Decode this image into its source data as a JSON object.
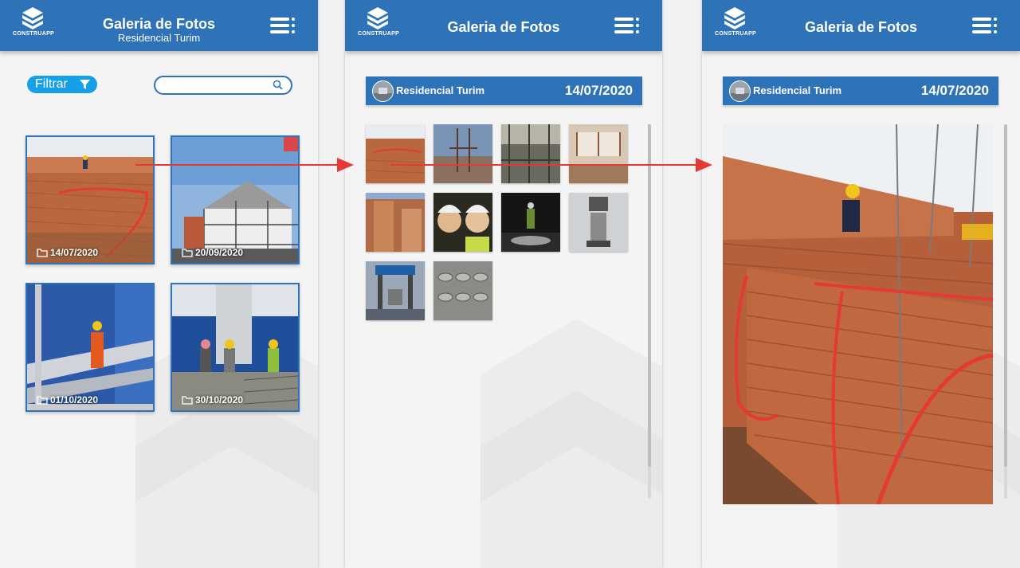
{
  "app": {
    "logo_text": "CONSTRUAPP"
  },
  "screen1": {
    "title": "Galeria de Fotos",
    "subtitle": "Residencial Turim",
    "filter_label": "Filtrar",
    "search_placeholder": "",
    "albums": [
      {
        "date": "14/07/2020"
      },
      {
        "date": "20/09/2020"
      },
      {
        "date": "01/10/2020"
      },
      {
        "date": "30/10/2020"
      }
    ]
  },
  "screen2": {
    "title": "Galeria de Fotos",
    "project_name": "Residencial Turim",
    "date": "14/07/2020",
    "thumbnail_count": 10
  },
  "screen3": {
    "title": "Galeria de Fotos",
    "project_name": "Residencial Turim",
    "date": "14/07/2020"
  },
  "colors": {
    "primary": "#2e72b8",
    "filter_button": "#15a0e8",
    "arrow": "#e53935",
    "background": "#f4f4f4"
  },
  "icons": [
    "construapp-logo-icon",
    "menu-list-icon",
    "filter-icon",
    "search-icon",
    "folder-icon",
    "project-avatar-icon"
  ]
}
